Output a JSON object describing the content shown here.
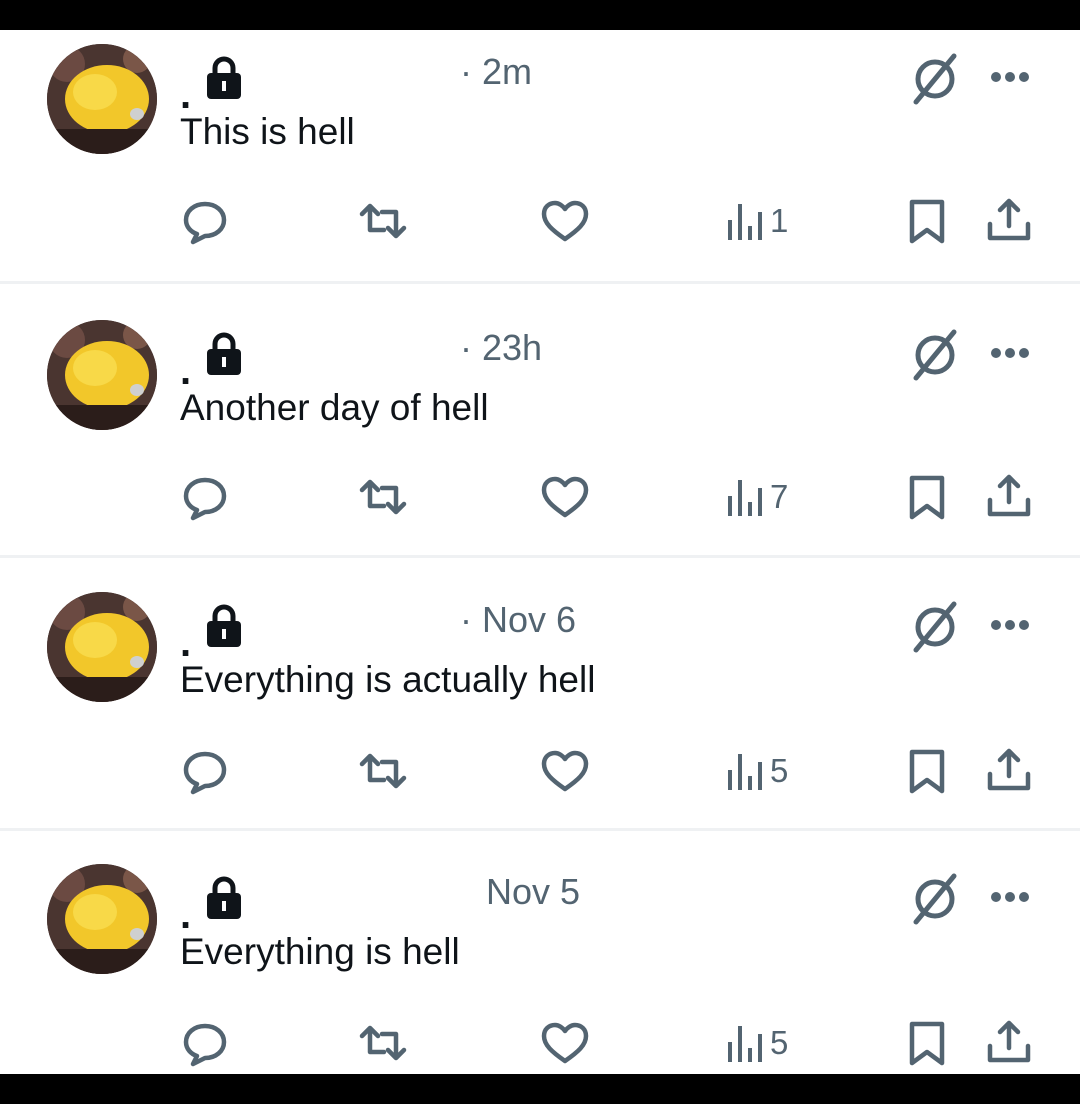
{
  "theme": {
    "text_primary": "#0f1419",
    "text_secondary": "#536471",
    "icon_color": "#536471",
    "avatar_fish": "#f2c72a"
  },
  "posts": [
    {
      "name": ".",
      "timestamp": "· 2m",
      "text": "This is hell",
      "views": "1",
      "icons": [
        "reply-icon",
        "retweet-icon",
        "like-icon",
        "views-icon",
        "bookmark-icon",
        "share-icon",
        "grok-icon",
        "more-icon",
        "lock-icon"
      ]
    },
    {
      "name": ".",
      "timestamp": "· 23h",
      "text": "Another day of hell",
      "views": "7"
    },
    {
      "name": ".",
      "timestamp": "· Nov 6",
      "text": "Everything is actually hell",
      "views": "5"
    },
    {
      "name": ".",
      "timestamp": "Nov 5",
      "text": "Everything is hell",
      "views": "5"
    }
  ]
}
